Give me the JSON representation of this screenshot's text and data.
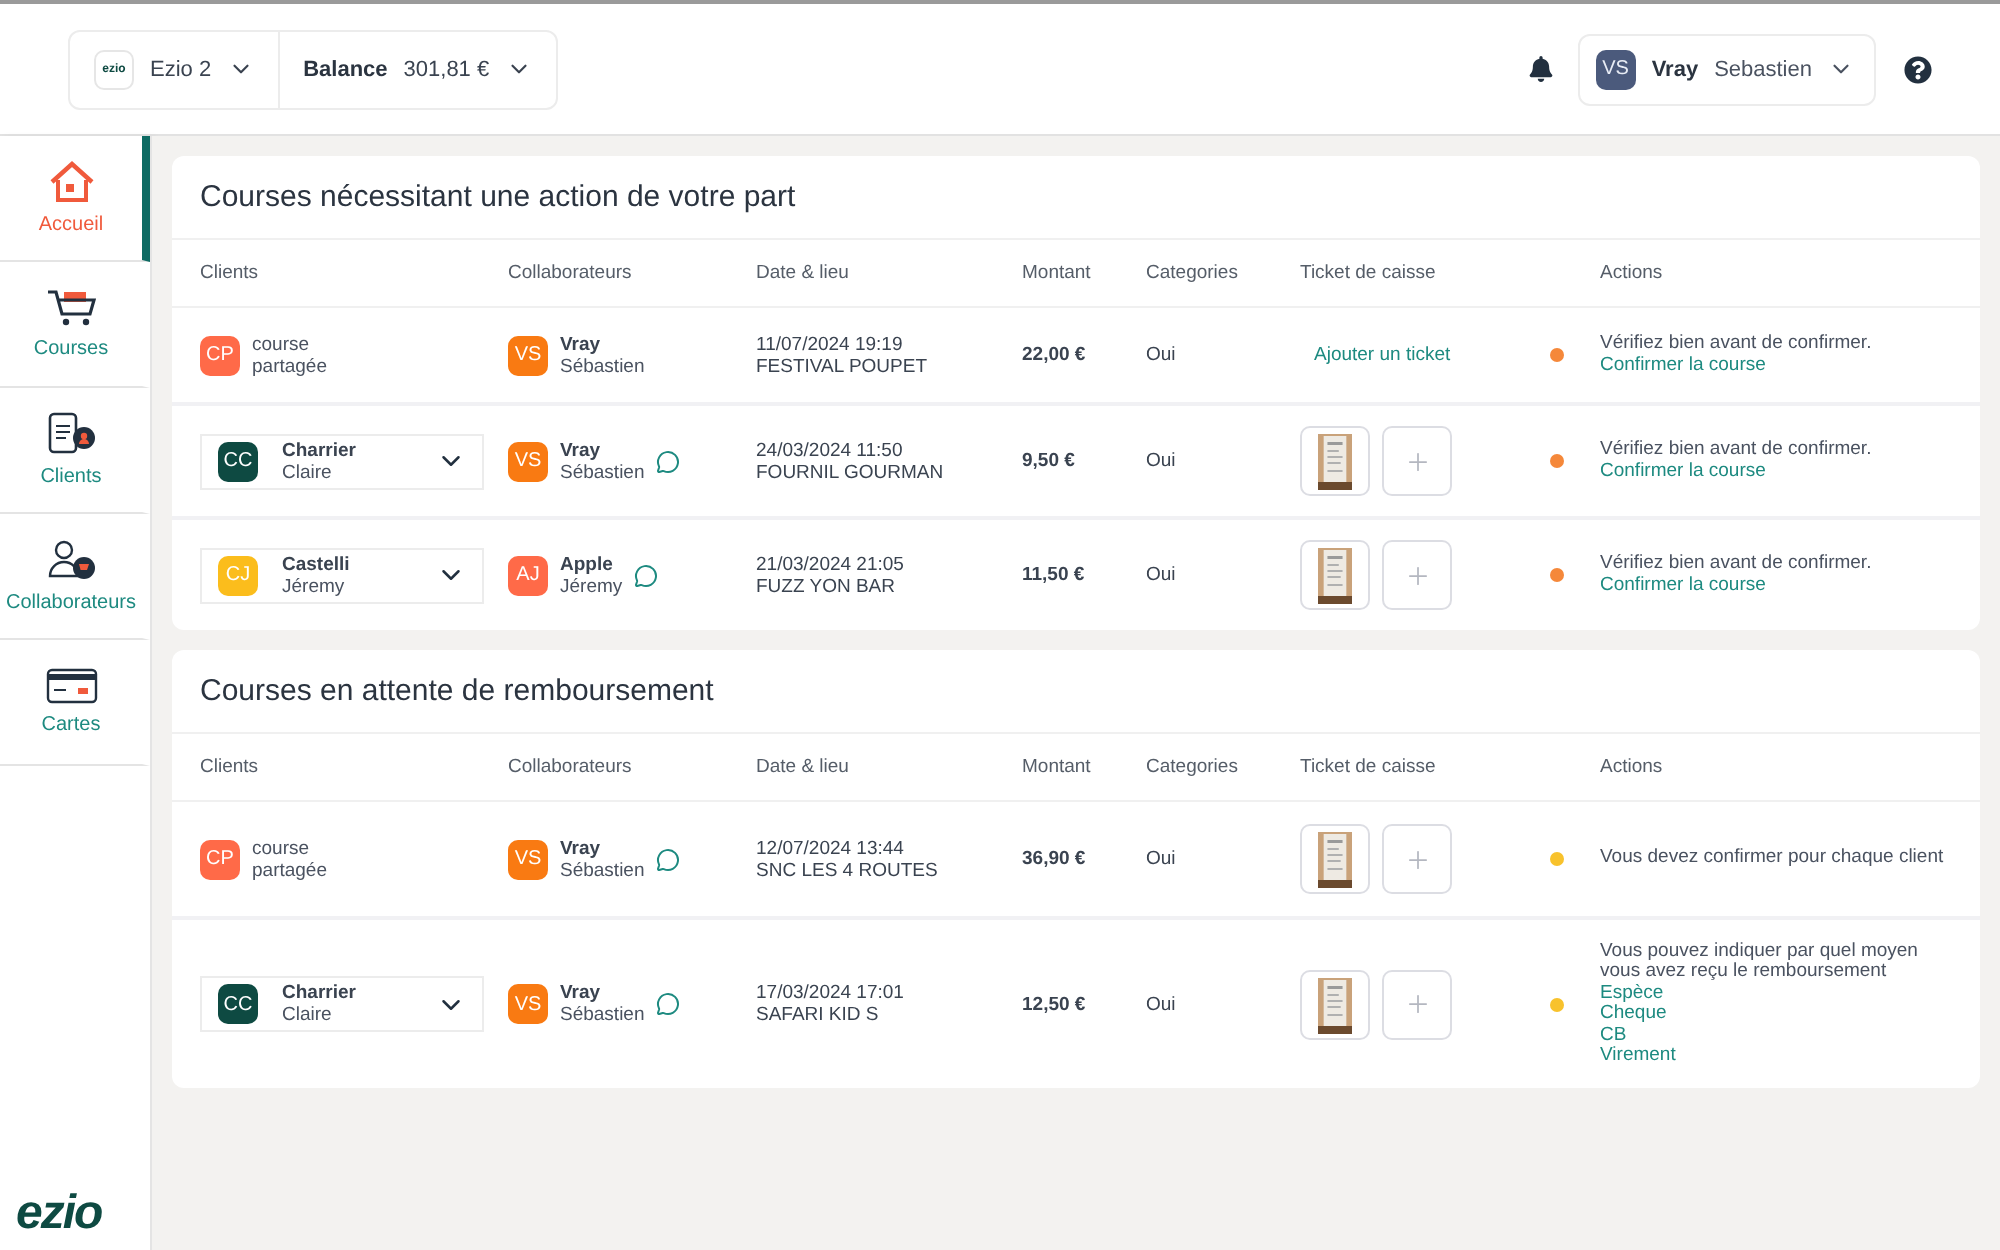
{
  "header": {
    "account": {
      "logo": "ezio",
      "name": "Ezio 2"
    },
    "balance": {
      "label": "Balance",
      "value": "301,81 €"
    },
    "user": {
      "initials": "VS",
      "last_name": "Vray",
      "first_name": "Sebastien"
    }
  },
  "sidebar": {
    "items": [
      {
        "kind": "home",
        "label": "Accueil",
        "selected": true
      },
      {
        "kind": "cart",
        "label": "Courses",
        "selected": false
      },
      {
        "kind": "clients",
        "label": "Clients",
        "selected": false
      },
      {
        "kind": "collaborators",
        "label": "Collaborateurs",
        "selected": false
      },
      {
        "kind": "card",
        "label": "Cartes",
        "selected": false
      }
    ],
    "logo": "ezio"
  },
  "sections": [
    {
      "title": "Courses nécessitant une action de votre part",
      "columns": [
        "Clients",
        "Collaborateurs",
        "Date & lieu",
        "Montant",
        "Categories",
        "Ticket de caisse",
        "Actions"
      ],
      "rows": [
        {
          "client": {
            "kind": "shared",
            "initials": "CP",
            "color": "#ff6a48",
            "line1": "course",
            "line2": "partagée"
          },
          "collaborator": {
            "initials": "VS",
            "color": "#f97a12",
            "last_name": "Vray",
            "first_name": "Sébastien",
            "comment": false
          },
          "date": "11/07/2024 19:19",
          "place": "FESTIVAL POUPET",
          "amount": "22,00 €",
          "categories": "Oui",
          "ticket": {
            "kind": "link",
            "label": "Ajouter un ticket"
          },
          "status": {
            "color": "#f5883a"
          },
          "action": {
            "text": "Vérifiez bien avant de confirmer.",
            "links": [
              "Confirmer la course"
            ]
          }
        },
        {
          "client": {
            "kind": "select",
            "initials": "CC",
            "color": "#0e4a42",
            "line1": "Charrier",
            "line2": "Claire"
          },
          "collaborator": {
            "initials": "VS",
            "color": "#f97a12",
            "last_name": "Vray",
            "first_name": "Sébastien",
            "comment": true
          },
          "date": "24/03/2024 11:50",
          "place": "FOURNIL GOURMAN",
          "amount": "9,50 €",
          "categories": "Oui",
          "ticket": {
            "kind": "photos"
          },
          "status": {
            "color": "#f5883a"
          },
          "action": {
            "text": "Vérifiez bien avant de confirmer.",
            "links": [
              "Confirmer la course"
            ]
          }
        },
        {
          "client": {
            "kind": "select",
            "initials": "CJ",
            "color": "#fbbd1c",
            "line1": "Castelli",
            "line2": "Jéremy"
          },
          "collaborator": {
            "initials": "AJ",
            "color": "#ff6a48",
            "last_name": "Apple",
            "first_name": "Jéremy",
            "comment": true
          },
          "date": "21/03/2024 21:05",
          "place": "FUZZ YON BAR",
          "amount": "11,50 €",
          "categories": "Oui",
          "ticket": {
            "kind": "photos"
          },
          "status": {
            "color": "#f5883a"
          },
          "action": {
            "text": "Vérifiez bien avant de confirmer.",
            "links": [
              "Confirmer la course"
            ]
          }
        }
      ]
    },
    {
      "title": "Courses en attente de remboursement",
      "columns": [
        "Clients",
        "Collaborateurs",
        "Date & lieu",
        "Montant",
        "Categories",
        "Ticket de caisse",
        "Actions"
      ],
      "rows": [
        {
          "client": {
            "kind": "shared",
            "initials": "CP",
            "color": "#ff6a48",
            "line1": "course",
            "line2": "partagée"
          },
          "collaborator": {
            "initials": "VS",
            "color": "#f97a12",
            "last_name": "Vray",
            "first_name": "Sébastien",
            "comment": true
          },
          "date": "12/07/2024 13:44",
          "place": "SNC LES 4 ROUTES",
          "amount": "36,90 €",
          "categories": "Oui",
          "ticket": {
            "kind": "photos"
          },
          "status": {
            "color": "#f8c22c"
          },
          "action": {
            "text": "Vous devez confirmer pour chaque client"
          }
        },
        {
          "client": {
            "kind": "select",
            "initials": "CC",
            "color": "#0e4a42",
            "line1": "Charrier",
            "line2": "Claire"
          },
          "collaborator": {
            "initials": "VS",
            "color": "#f97a12",
            "last_name": "Vray",
            "first_name": "Sébastien",
            "comment": true
          },
          "date": "17/03/2024 17:01",
          "place": "SAFARI KID S",
          "amount": "12,50 €",
          "categories": "Oui",
          "ticket": {
            "kind": "photos"
          },
          "status": {
            "color": "#f8c22c"
          },
          "action": {
            "text": "Vous pouvez indiquer par quel moyen vous avez reçu le remboursement",
            "links": [
              "Espèce",
              "Cheque",
              "CB",
              "Virement"
            ]
          }
        }
      ]
    }
  ]
}
